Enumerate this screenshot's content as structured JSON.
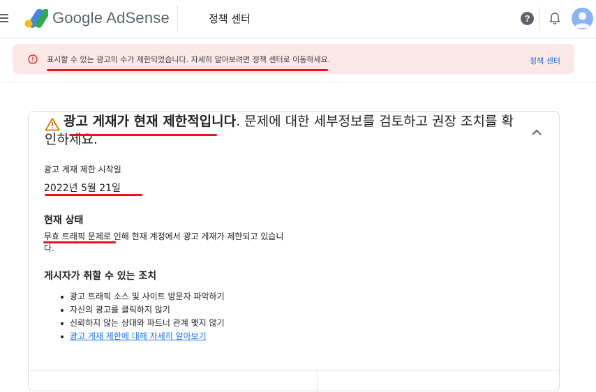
{
  "header": {
    "brand": "Google AdSense",
    "page_name": "정책 센터"
  },
  "alert": {
    "text": "표시할 수 있는 광고의 수가 제한되었습니다. 자세히 알아보려면 정책 센터로 이동하세요.",
    "link": "정책 센터"
  },
  "card": {
    "title_bold": "광고 게재가 현재 제한적입니다",
    "title_rest": ". 문제에 대한 세부정보를 검토하고 권장 조치를 확인하세요.",
    "start_label": "광고 게재 제한 시작일",
    "start_date": "2022년 5월 21일",
    "status_heading": "현재 상태",
    "status_text": "무효 트래픽 문제로 인해 현재 계정에서 광고 게재가 제한되고 있습니다.",
    "actions_heading": "게시자가 취할 수 있는 조치",
    "actions": [
      "광고 트래픽 소스 및 사이트 방문자 파악하기",
      "자신의 광고를 클릭하지 않기",
      "신뢰하지 않는 상대와 파트너 관계 맺지 않기"
    ],
    "learn_more": "광고 게재 제한에 대해 자세히 알아보기"
  },
  "colors": {
    "alert_bg": "#fce8e6",
    "alert_icon": "#d93025",
    "link": "#1a73e8",
    "warning": "#e37400",
    "annotation": "#e8141d"
  }
}
